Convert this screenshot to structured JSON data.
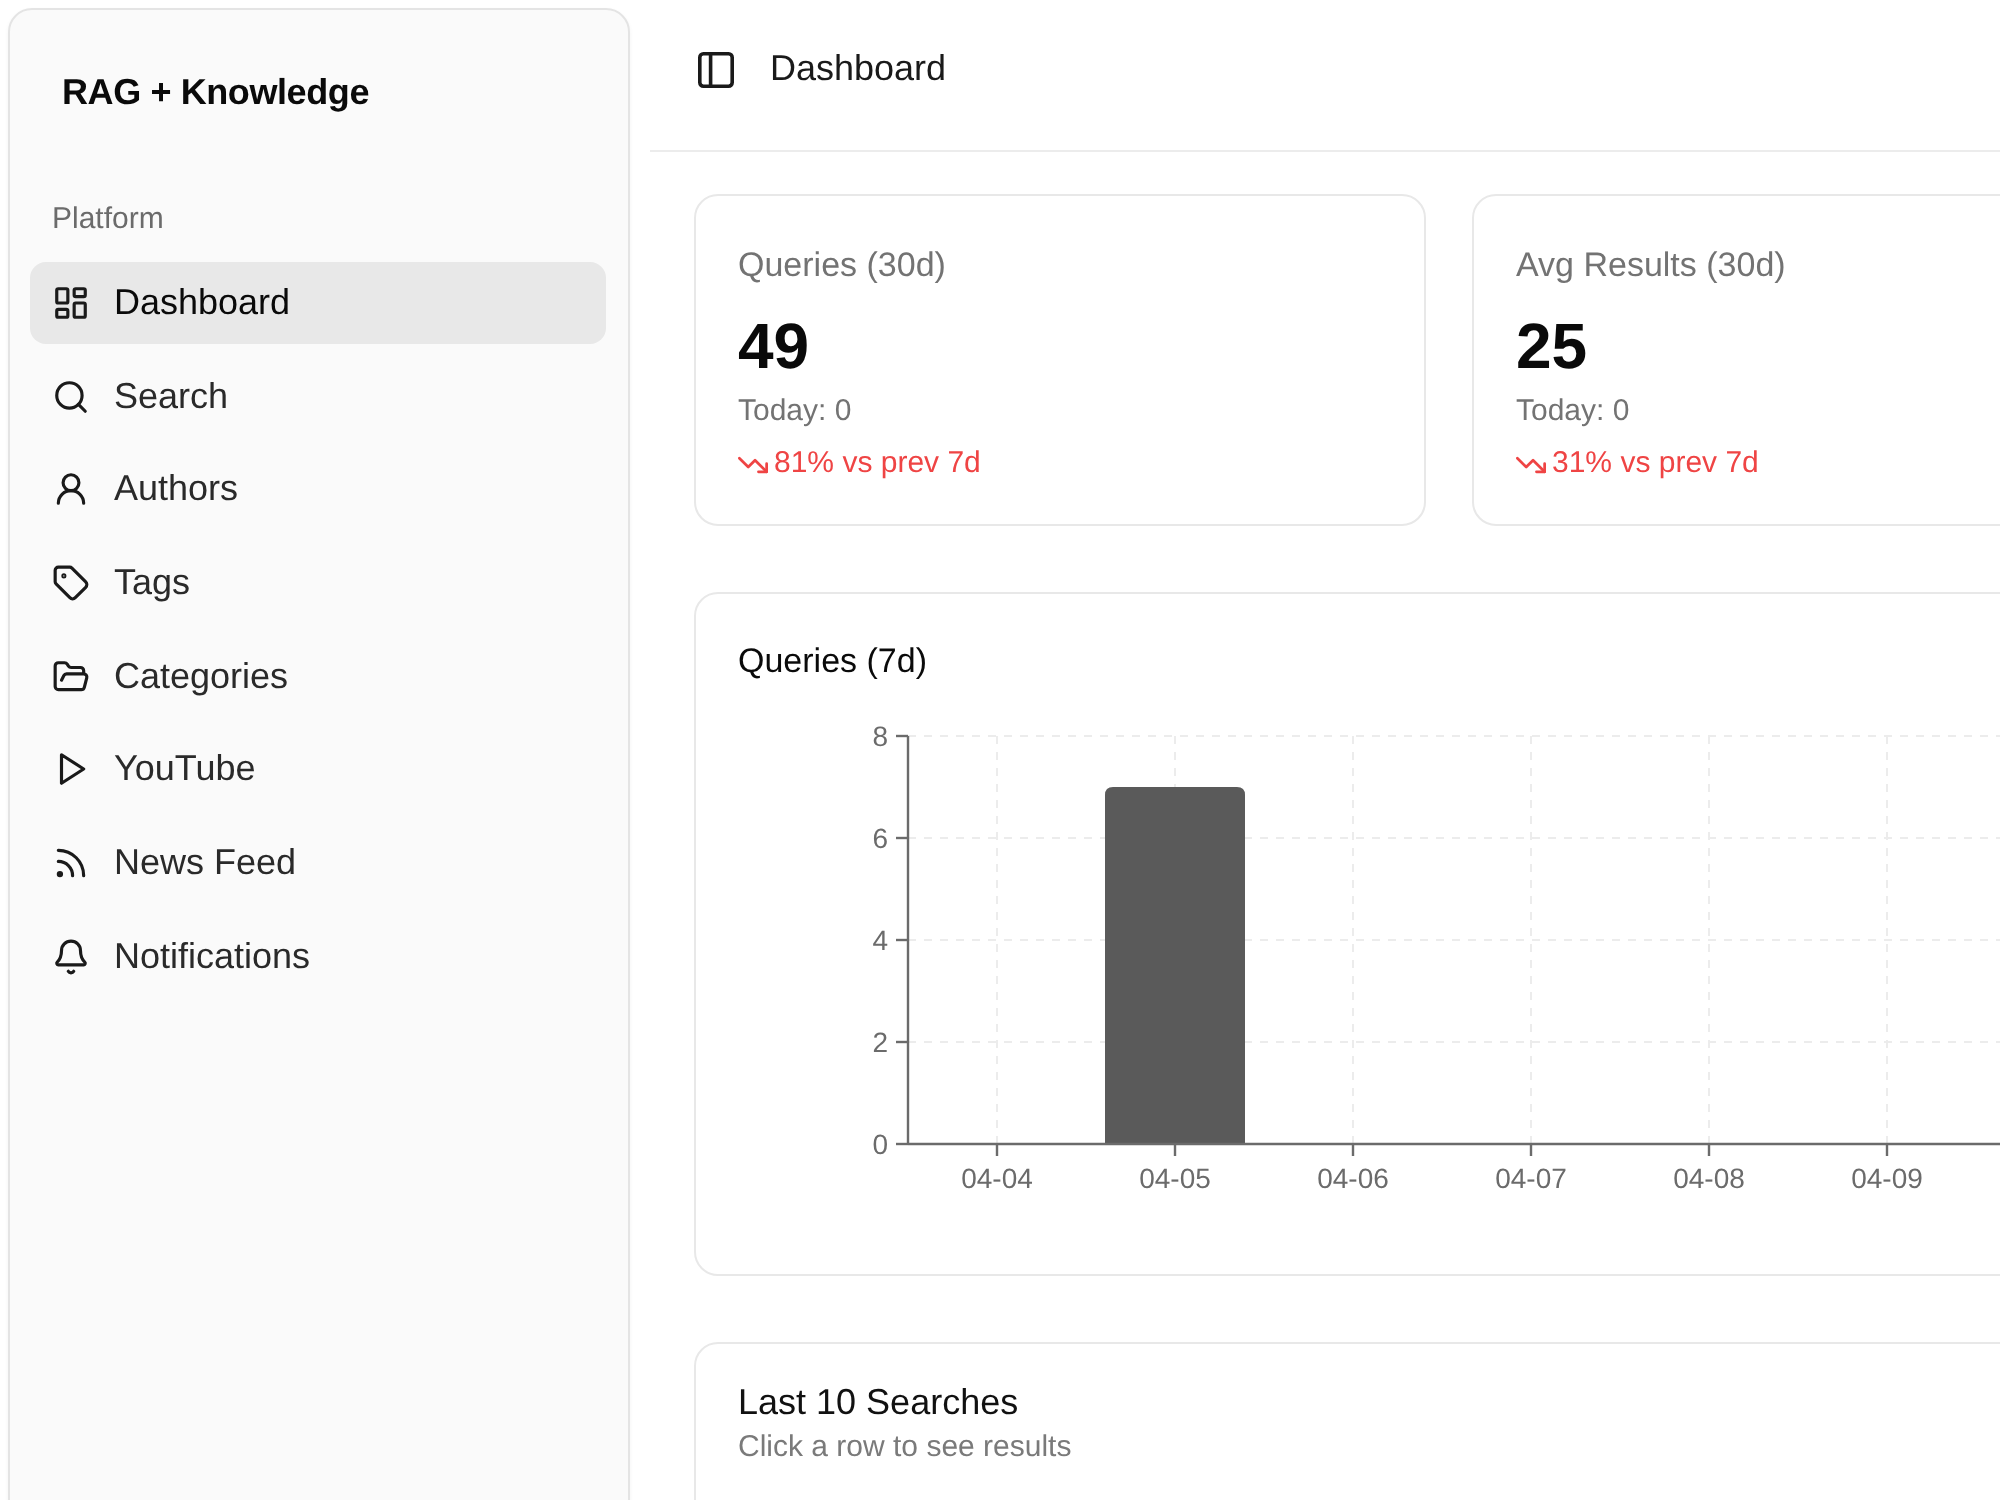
{
  "sidebar": {
    "title": "RAG + Knowledge",
    "section": "Platform",
    "items": [
      {
        "label": "Dashboard",
        "selected": true
      },
      {
        "label": "Search",
        "selected": false
      },
      {
        "label": "Authors",
        "selected": false
      },
      {
        "label": "Tags",
        "selected": false
      },
      {
        "label": "Categories",
        "selected": false
      },
      {
        "label": "YouTube",
        "selected": false
      },
      {
        "label": "News Feed",
        "selected": false
      },
      {
        "label": "Notifications",
        "selected": false
      }
    ]
  },
  "header": {
    "title": "Dashboard"
  },
  "stats": [
    {
      "label": "Queries (30d)",
      "value": "49",
      "today": "Today: 0",
      "trend": "81% vs prev 7d",
      "falling": true
    },
    {
      "label": "Avg Results (30d)",
      "value": "25",
      "today": "Today: 0",
      "trend": "31% vs prev 7d",
      "falling": true
    }
  ],
  "chart_card": {
    "title": "Queries (7d)",
    "chart_data": {
      "type": "bar",
      "categories": [
        "04-04",
        "04-05",
        "04-06",
        "04-07",
        "04-08",
        "04-09"
      ],
      "values": [
        0,
        7,
        0,
        0,
        0,
        0
      ],
      "ylim": [
        0,
        8
      ],
      "yticks": [
        0,
        2,
        4,
        6,
        8
      ],
      "grid": true
    }
  },
  "recent": {
    "title": "Last 10 Searches",
    "subtitle": "Click a row to see results"
  }
}
